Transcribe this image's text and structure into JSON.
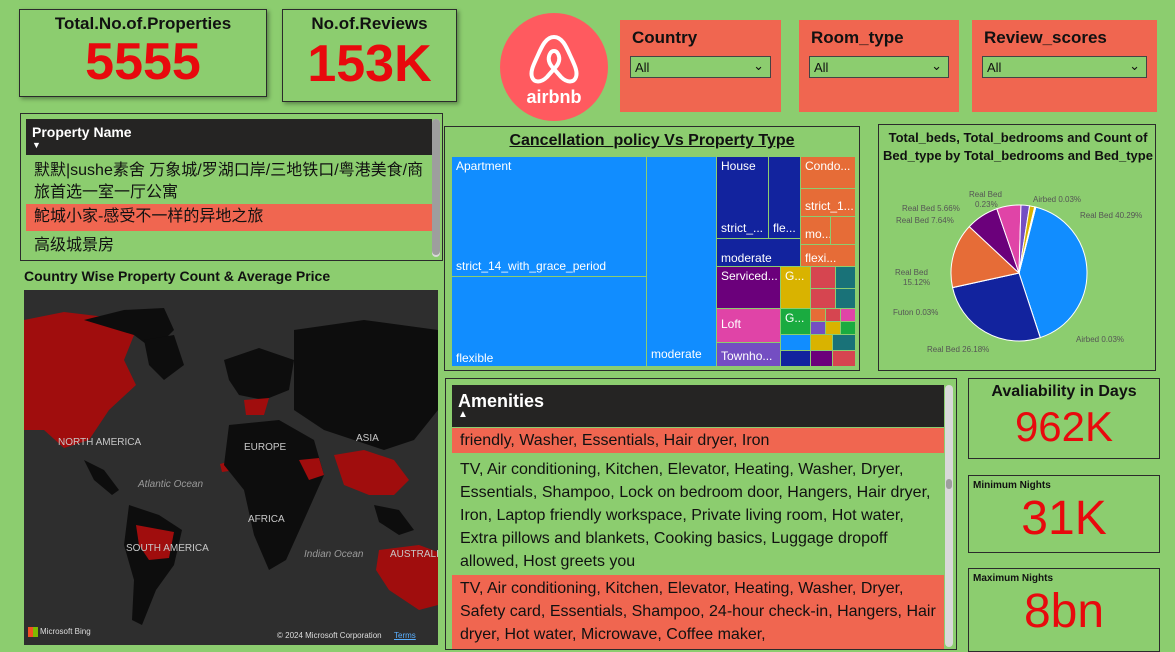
{
  "kpis": {
    "properties": {
      "title": "Total.No.of.Properties",
      "value": "5555"
    },
    "reviews": {
      "title": "No.of.Reviews",
      "value": "153K"
    },
    "availability": {
      "title": "Avaliability in Days",
      "value": "962K"
    },
    "min_nights": {
      "title": "Minimum Nights",
      "value": "31K"
    },
    "max_nights": {
      "title": "Maximum Nights",
      "value": "8bn"
    }
  },
  "logo": {
    "text": "airbnb"
  },
  "slicers": [
    {
      "label": "Country",
      "value": "All"
    },
    {
      "label": "Room_type",
      "value": "All"
    },
    {
      "label": "Review_scores",
      "value": "All"
    }
  ],
  "property_table": {
    "header": "Property Name",
    "rows": [
      "默默|sushe素舍 万象城/罗湖口岸/三地铁口/粤港美食/商旅首选一室一厅公寓",
      "鮀城小家-感受不一样的异地之旅",
      "高级城景房"
    ]
  },
  "map": {
    "title": "Country Wise Property Count & Average Price",
    "labels": [
      "NORTH AMERICA",
      "EUROPE",
      "ASIA",
      "Atlantic Ocean",
      "AFRICA",
      "SOUTH AMERICA",
      "Indian Ocean",
      "AUSTRALIA"
    ],
    "attribution": "Microsoft Bing",
    "copyright": "© 2024 Microsoft Corporation",
    "terms": "Terms"
  },
  "treemap": {
    "title": "Cancellation_policy Vs Property Type",
    "labels": {
      "apartment": "Apartment",
      "strict_grace": "strict_14_with_grace_period",
      "flexible": "flexible",
      "moderate": "moderate",
      "house": "House",
      "house_strict": "strict_...",
      "house_fle": "fle...",
      "house_moderate": "moderate",
      "condo": "Condo...",
      "condo_strict": "strict_1...",
      "condo_mo": "mo...",
      "condo_flexi": "flexi...",
      "serviced": "Serviced...",
      "g1": "G...",
      "loft": "Loft",
      "g2": "G...",
      "townhouse": "Townho..."
    },
    "colors": {
      "blue": "#118dff",
      "navy": "#12239e",
      "orange": "#e66c37",
      "purple": "#6b007b",
      "pink": "#e044a7",
      "yellow": "#d9b300",
      "green": "#1aab40",
      "red": "#d64550",
      "teal": "#197278"
    }
  },
  "pie": {
    "title": "Total_beds, Total_bedrooms and Count of Bed_type by Total_bedrooms and Bed_type",
    "labels": [
      {
        "text": "Real Bed"
      },
      {
        "text": "0.23%"
      },
      {
        "text": "Airbed 0.03%"
      },
      {
        "text": "Real Bed 5.66%"
      },
      {
        "text": "Real Bed 7.64%"
      },
      {
        "text": "Real Bed 40.29%"
      },
      {
        "text": "Real Bed"
      },
      {
        "text": "15.12%"
      },
      {
        "text": "Futon 0.03%"
      },
      {
        "text": "Airbed 0.03%"
      },
      {
        "text": "Real Bed 26.18%"
      }
    ],
    "slices": [
      {
        "value": 40.29,
        "color": "#118dff"
      },
      {
        "value": 0.03,
        "color": "#12239e"
      },
      {
        "value": 26.18,
        "color": "#12239e"
      },
      {
        "value": 0.03,
        "color": "#e66c37"
      },
      {
        "value": 15.12,
        "color": "#e66c37"
      },
      {
        "value": 7.64,
        "color": "#6b007b"
      },
      {
        "value": 5.66,
        "color": "#e044a7"
      },
      {
        "value": 2.0,
        "color": "#744ec2"
      },
      {
        "value": 1.2,
        "color": "#d9b300"
      },
      {
        "value": 0.23,
        "color": "#197278"
      },
      {
        "value": 0.03,
        "color": "#d64550"
      }
    ]
  },
  "amenities": {
    "header": "Amenities",
    "rows": [
      "friendly, Washer, Essentials, Hair dryer, Iron",
      "TV, Air conditioning, Kitchen, Elevator, Heating, Washer, Dryer, Essentials, Shampoo, Lock on bedroom door, Hangers, Hair dryer, Iron, Laptop friendly workspace, Private living room, Hot water, Extra pillows and blankets, Cooking basics, Luggage dropoff allowed, Host greets you",
      "TV, Air conditioning, Kitchen, Elevator, Heating, Washer, Dryer, Safety card, Essentials, Shampoo, 24-hour check-in, Hangers, Hair dryer, Hot water, Microwave, Coffee maker,"
    ]
  }
}
